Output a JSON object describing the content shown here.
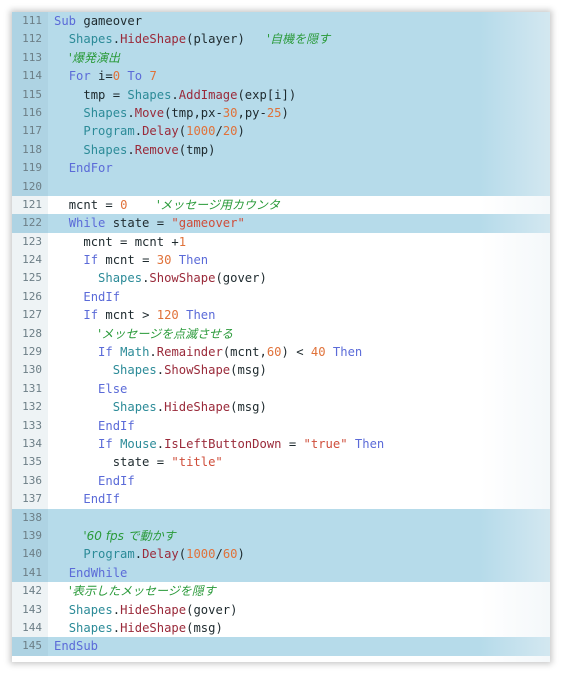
{
  "editor": {
    "highlight_color": "#b6dbea",
    "lines": [
      {
        "n": "111",
        "hl": true,
        "indent": 0,
        "tokens": [
          {
            "t": "kw",
            "v": "Sub"
          },
          {
            "t": "op",
            "v": " gameover"
          }
        ]
      },
      {
        "n": "112",
        "hl": true,
        "indent": 1,
        "tokens": [
          {
            "t": "obj",
            "v": "Shapes"
          },
          {
            "t": "op",
            "v": "."
          },
          {
            "t": "meth",
            "v": "HideShape"
          },
          {
            "t": "op",
            "v": "(player)   "
          },
          {
            "t": "cmt",
            "v": "'自機を隠す"
          }
        ]
      },
      {
        "n": "113",
        "hl": true,
        "indent": 1,
        "tokens": [
          {
            "t": "cmt",
            "v": "'爆発演出"
          }
        ]
      },
      {
        "n": "114",
        "hl": true,
        "indent": 1,
        "tokens": [
          {
            "t": "kw",
            "v": "For"
          },
          {
            "t": "op",
            "v": " i="
          },
          {
            "t": "num",
            "v": "0"
          },
          {
            "t": "op",
            "v": " "
          },
          {
            "t": "kw",
            "v": "To"
          },
          {
            "t": "op",
            "v": " "
          },
          {
            "t": "num",
            "v": "7"
          }
        ]
      },
      {
        "n": "115",
        "hl": true,
        "indent": 2,
        "tokens": [
          {
            "t": "op",
            "v": "tmp = "
          },
          {
            "t": "obj",
            "v": "Shapes"
          },
          {
            "t": "op",
            "v": "."
          },
          {
            "t": "meth",
            "v": "AddImage"
          },
          {
            "t": "op",
            "v": "(exp[i])"
          }
        ]
      },
      {
        "n": "116",
        "hl": true,
        "indent": 2,
        "tokens": [
          {
            "t": "obj",
            "v": "Shapes"
          },
          {
            "t": "op",
            "v": "."
          },
          {
            "t": "meth",
            "v": "Move"
          },
          {
            "t": "op",
            "v": "(tmp,px-"
          },
          {
            "t": "num",
            "v": "30"
          },
          {
            "t": "op",
            "v": ",py-"
          },
          {
            "t": "num",
            "v": "25"
          },
          {
            "t": "op",
            "v": ")"
          }
        ]
      },
      {
        "n": "117",
        "hl": true,
        "indent": 2,
        "tokens": [
          {
            "t": "obj",
            "v": "Program"
          },
          {
            "t": "op",
            "v": "."
          },
          {
            "t": "meth",
            "v": "Delay"
          },
          {
            "t": "op",
            "v": "("
          },
          {
            "t": "num",
            "v": "1000"
          },
          {
            "t": "op",
            "v": "/"
          },
          {
            "t": "num",
            "v": "20"
          },
          {
            "t": "op",
            "v": ")"
          }
        ]
      },
      {
        "n": "118",
        "hl": true,
        "indent": 2,
        "tokens": [
          {
            "t": "obj",
            "v": "Shapes"
          },
          {
            "t": "op",
            "v": "."
          },
          {
            "t": "meth",
            "v": "Remove"
          },
          {
            "t": "op",
            "v": "(tmp)"
          }
        ]
      },
      {
        "n": "119",
        "hl": true,
        "indent": 1,
        "tokens": [
          {
            "t": "kw",
            "v": "EndFor"
          }
        ]
      },
      {
        "n": "120",
        "hl": true,
        "indent": 0,
        "tokens": []
      },
      {
        "n": "121",
        "hl": false,
        "indent": 1,
        "tokens": [
          {
            "t": "op",
            "v": "mcnt = "
          },
          {
            "t": "num",
            "v": "0"
          },
          {
            "t": "op",
            "v": "    "
          },
          {
            "t": "cmt",
            "v": "'メッセージ用カウンタ"
          }
        ]
      },
      {
        "n": "122",
        "hl": true,
        "indent": 1,
        "tokens": [
          {
            "t": "kw",
            "v": "While"
          },
          {
            "t": "op",
            "v": " state = "
          },
          {
            "t": "str",
            "v": "\"gameover\""
          }
        ]
      },
      {
        "n": "123",
        "hl": false,
        "indent": 2,
        "tokens": [
          {
            "t": "op",
            "v": "mcnt = mcnt +"
          },
          {
            "t": "num",
            "v": "1"
          }
        ]
      },
      {
        "n": "124",
        "hl": false,
        "indent": 2,
        "tokens": [
          {
            "t": "kw",
            "v": "If"
          },
          {
            "t": "op",
            "v": " mcnt = "
          },
          {
            "t": "num",
            "v": "30"
          },
          {
            "t": "op",
            "v": " "
          },
          {
            "t": "kw",
            "v": "Then"
          }
        ]
      },
      {
        "n": "125",
        "hl": false,
        "indent": 3,
        "tokens": [
          {
            "t": "obj",
            "v": "Shapes"
          },
          {
            "t": "op",
            "v": "."
          },
          {
            "t": "meth",
            "v": "ShowShape"
          },
          {
            "t": "op",
            "v": "(gover)"
          }
        ]
      },
      {
        "n": "126",
        "hl": false,
        "indent": 2,
        "tokens": [
          {
            "t": "kw",
            "v": "EndIf"
          }
        ]
      },
      {
        "n": "127",
        "hl": false,
        "indent": 2,
        "tokens": [
          {
            "t": "kw",
            "v": "If"
          },
          {
            "t": "op",
            "v": " mcnt > "
          },
          {
            "t": "num",
            "v": "120"
          },
          {
            "t": "op",
            "v": " "
          },
          {
            "t": "kw",
            "v": "Then"
          }
        ]
      },
      {
        "n": "128",
        "hl": false,
        "indent": 3,
        "tokens": [
          {
            "t": "cmt",
            "v": "'メッセージを点滅させる"
          }
        ]
      },
      {
        "n": "129",
        "hl": false,
        "indent": 3,
        "tokens": [
          {
            "t": "kw",
            "v": "If"
          },
          {
            "t": "op",
            "v": " "
          },
          {
            "t": "obj",
            "v": "Math"
          },
          {
            "t": "op",
            "v": "."
          },
          {
            "t": "meth",
            "v": "Remainder"
          },
          {
            "t": "op",
            "v": "(mcnt,"
          },
          {
            "t": "num",
            "v": "60"
          },
          {
            "t": "op",
            "v": ") < "
          },
          {
            "t": "num",
            "v": "40"
          },
          {
            "t": "op",
            "v": " "
          },
          {
            "t": "kw",
            "v": "Then"
          }
        ]
      },
      {
        "n": "130",
        "hl": false,
        "indent": 4,
        "tokens": [
          {
            "t": "obj",
            "v": "Shapes"
          },
          {
            "t": "op",
            "v": "."
          },
          {
            "t": "meth",
            "v": "ShowShape"
          },
          {
            "t": "op",
            "v": "(msg)"
          }
        ]
      },
      {
        "n": "131",
        "hl": false,
        "indent": 3,
        "tokens": [
          {
            "t": "kw",
            "v": "Else"
          }
        ]
      },
      {
        "n": "132",
        "hl": false,
        "indent": 4,
        "tokens": [
          {
            "t": "obj",
            "v": "Shapes"
          },
          {
            "t": "op",
            "v": "."
          },
          {
            "t": "meth",
            "v": "HideShape"
          },
          {
            "t": "op",
            "v": "(msg)"
          }
        ]
      },
      {
        "n": "133",
        "hl": false,
        "indent": 3,
        "tokens": [
          {
            "t": "kw",
            "v": "EndIf"
          }
        ]
      },
      {
        "n": "134",
        "hl": false,
        "indent": 3,
        "tokens": [
          {
            "t": "kw",
            "v": "If"
          },
          {
            "t": "op",
            "v": " "
          },
          {
            "t": "obj",
            "v": "Mouse"
          },
          {
            "t": "op",
            "v": "."
          },
          {
            "t": "meth",
            "v": "IsLeftButtonDown"
          },
          {
            "t": "op",
            "v": " = "
          },
          {
            "t": "str",
            "v": "\"true\""
          },
          {
            "t": "op",
            "v": " "
          },
          {
            "t": "kw",
            "v": "Then"
          }
        ]
      },
      {
        "n": "135",
        "hl": false,
        "indent": 4,
        "tokens": [
          {
            "t": "op",
            "v": "state = "
          },
          {
            "t": "str",
            "v": "\"title\""
          }
        ]
      },
      {
        "n": "136",
        "hl": false,
        "indent": 3,
        "tokens": [
          {
            "t": "kw",
            "v": "EndIf"
          }
        ]
      },
      {
        "n": "137",
        "hl": false,
        "indent": 2,
        "tokens": [
          {
            "t": "kw",
            "v": "EndIf"
          }
        ]
      },
      {
        "n": "138",
        "hl": true,
        "indent": 0,
        "tokens": []
      },
      {
        "n": "139",
        "hl": true,
        "indent": 2,
        "tokens": [
          {
            "t": "cmt",
            "v": "'60 fps で動かす"
          }
        ]
      },
      {
        "n": "140",
        "hl": true,
        "indent": 2,
        "tokens": [
          {
            "t": "obj",
            "v": "Program"
          },
          {
            "t": "op",
            "v": "."
          },
          {
            "t": "meth",
            "v": "Delay"
          },
          {
            "t": "op",
            "v": "("
          },
          {
            "t": "num",
            "v": "1000"
          },
          {
            "t": "op",
            "v": "/"
          },
          {
            "t": "num",
            "v": "60"
          },
          {
            "t": "op",
            "v": ")"
          }
        ]
      },
      {
        "n": "141",
        "hl": true,
        "indent": 1,
        "tokens": [
          {
            "t": "kw",
            "v": "EndWhile"
          }
        ]
      },
      {
        "n": "142",
        "hl": false,
        "indent": 1,
        "tokens": [
          {
            "t": "cmt",
            "v": "'表示したメッセージを隠す"
          }
        ]
      },
      {
        "n": "143",
        "hl": false,
        "indent": 1,
        "tokens": [
          {
            "t": "obj",
            "v": "Shapes"
          },
          {
            "t": "op",
            "v": "."
          },
          {
            "t": "meth",
            "v": "HideShape"
          },
          {
            "t": "op",
            "v": "(gover)"
          }
        ]
      },
      {
        "n": "144",
        "hl": false,
        "indent": 1,
        "tokens": [
          {
            "t": "obj",
            "v": "Shapes"
          },
          {
            "t": "op",
            "v": "."
          },
          {
            "t": "meth",
            "v": "HideShape"
          },
          {
            "t": "op",
            "v": "(msg)"
          }
        ]
      },
      {
        "n": "145",
        "hl": true,
        "indent": 0,
        "tokens": [
          {
            "t": "kw",
            "v": "EndSub"
          }
        ]
      }
    ]
  }
}
